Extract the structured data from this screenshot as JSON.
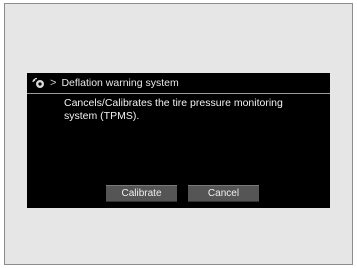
{
  "header": {
    "icon": "tire-settings-icon",
    "chevron": ">",
    "title": "Deflation warning system"
  },
  "description": "Cancels/Calibrates the tire pressure monitoring system (TPMS).",
  "buttons": {
    "calibrate_label": "Calibrate",
    "cancel_label": "Cancel"
  },
  "colors": {
    "screen_background": "#000000",
    "button_background": "#555555",
    "frame_background": "#e6e6e6"
  }
}
